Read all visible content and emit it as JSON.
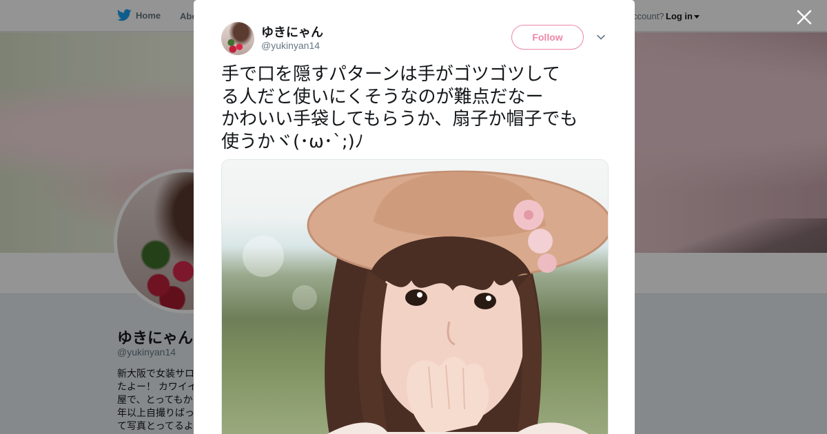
{
  "nav": {
    "home_label": "Home",
    "about_label": "Abo",
    "account_prompt": "ccount?",
    "login_label": "Log in"
  },
  "profile": {
    "name": "ゆきにゃん",
    "handle": "@yukinyan14",
    "bio_lines": [
      "新大阪で女装サロ",
      "たよー！ カワイイ",
      "屋で、とってもか",
      "年以上自撮りばっ",
      "て写真とってるよ"
    ]
  },
  "tweet": {
    "author_name": "ゆきにゃん",
    "author_handle": "@yukinyan14",
    "follow_label": "Follow",
    "text_lines": [
      "手で口を隠すパターンは手がゴツゴツして",
      "る人だと使いにくそうなのが難点だなー",
      "かわいい手袋してもらうか、扇子か帽子でも",
      "使うかヾ(･ω･`;)ﾉ"
    ]
  },
  "colors": {
    "twitter_blue": "#1da1f2",
    "follow_red": "#e0245e",
    "text_primary": "#14171a",
    "text_secondary": "#657786"
  },
  "icons": {
    "nav_logo": "twitter-bird-icon",
    "close": "close-icon",
    "menu": "chevron-down-icon"
  }
}
